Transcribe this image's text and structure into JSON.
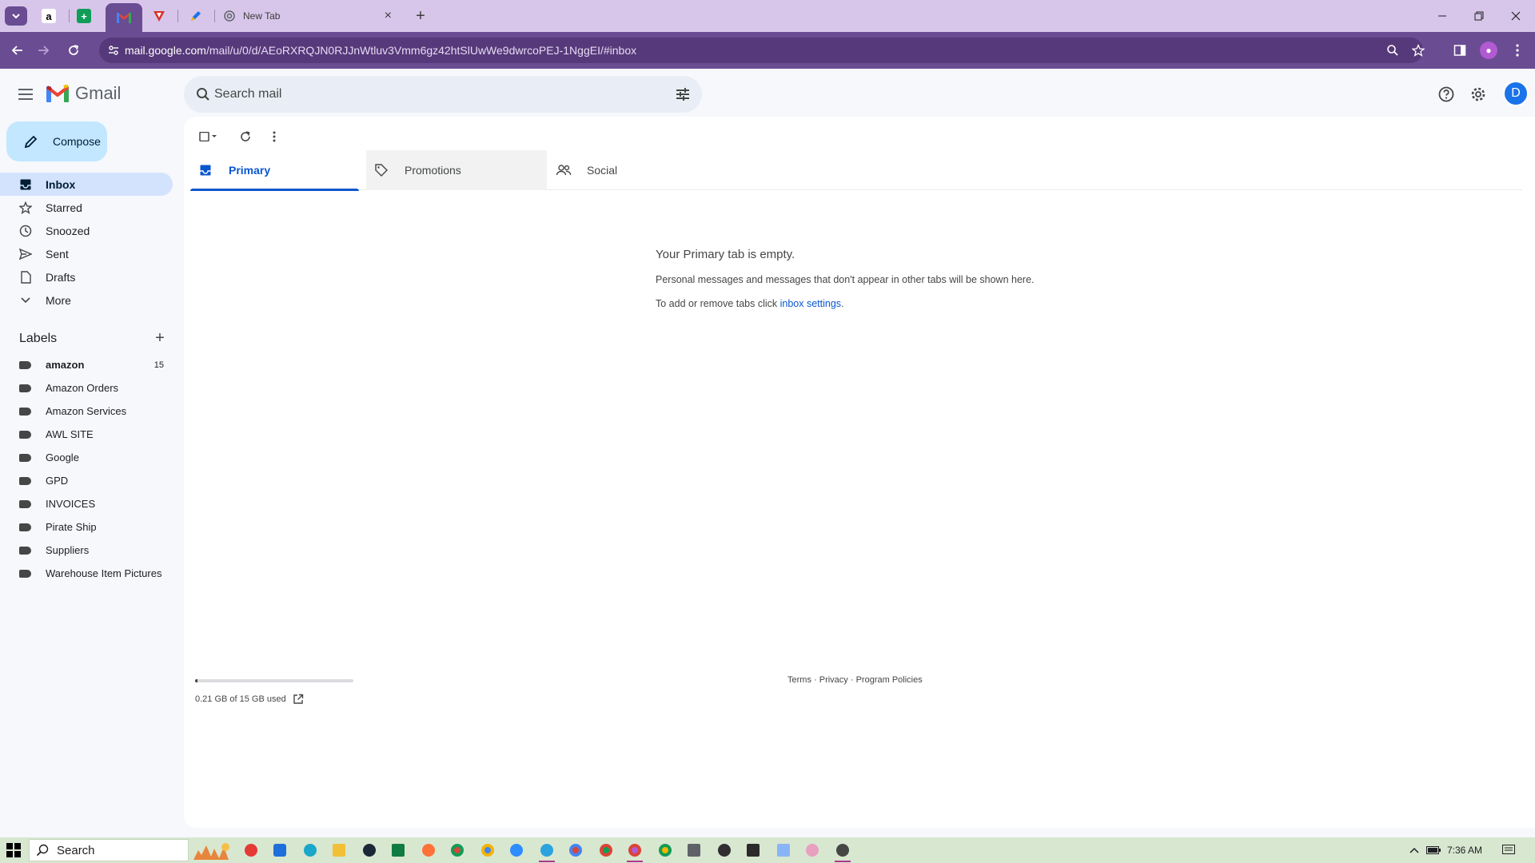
{
  "browser": {
    "tabs": [
      {
        "icon": "amazon-icon",
        "color": "#000000"
      },
      {
        "icon": "google-sheets-icon",
        "color": "#0f9d58"
      },
      {
        "icon": "gmail-icon",
        "color": "#ea4335",
        "active": true
      },
      {
        "icon": "vivaldi-red-icon",
        "color": "#d93025"
      },
      {
        "icon": "pen-icon",
        "color": "#1a73e8"
      }
    ],
    "new_tab_title": "New Tab",
    "url_host": "mail.google.com",
    "url_path": "/mail/u/0/d/AEoRXRQJN0RJJnWtluv3Vmm6gz42htSlUwWe9dwrcoPEJ-1NggEI/#inbox",
    "theme_color": "#6a4c93"
  },
  "gmail": {
    "app_name": "Gmail",
    "search_placeholder": "Search mail",
    "avatar_letter": "D",
    "compose_label": "Compose",
    "nav": [
      {
        "label": "Inbox",
        "icon": "inbox-icon",
        "active": true
      },
      {
        "label": "Starred",
        "icon": "star-icon"
      },
      {
        "label": "Snoozed",
        "icon": "clock-icon"
      },
      {
        "label": "Sent",
        "icon": "send-icon"
      },
      {
        "label": "Drafts",
        "icon": "draft-icon"
      },
      {
        "label": "More",
        "icon": "chevron-down-icon"
      }
    ],
    "labels_title": "Labels",
    "labels": [
      {
        "name": "amazon",
        "count": "15",
        "bold": true
      },
      {
        "name": "Amazon Orders"
      },
      {
        "name": "Amazon Services"
      },
      {
        "name": "AWL SITE"
      },
      {
        "name": "Google"
      },
      {
        "name": "GPD"
      },
      {
        "name": "INVOICES"
      },
      {
        "name": "Pirate Ship"
      },
      {
        "name": "Suppliers"
      },
      {
        "name": "Warehouse Item Pictures"
      }
    ],
    "tabs": [
      {
        "label": "Primary",
        "icon": "inbox-icon",
        "active": true
      },
      {
        "label": "Promotions",
        "icon": "tag-icon"
      },
      {
        "label": "Social",
        "icon": "people-icon"
      }
    ],
    "empty": {
      "heading": "Your Primary tab is empty.",
      "line1": "Personal messages and messages that don't appear in other tabs will be shown here.",
      "line2_prefix": "To add or remove tabs click ",
      "line2_link": "inbox settings",
      "line2_suffix": "."
    },
    "storage": {
      "text": "0.21 GB of 15 GB used",
      "used_fraction": 0.014
    },
    "footer": {
      "terms": "Terms",
      "sep1": " · ",
      "privacy": "Privacy",
      "sep2": " · ",
      "policies": "Program Policies"
    }
  },
  "taskbar": {
    "search_label": "Search",
    "time": "7:36 AM"
  }
}
